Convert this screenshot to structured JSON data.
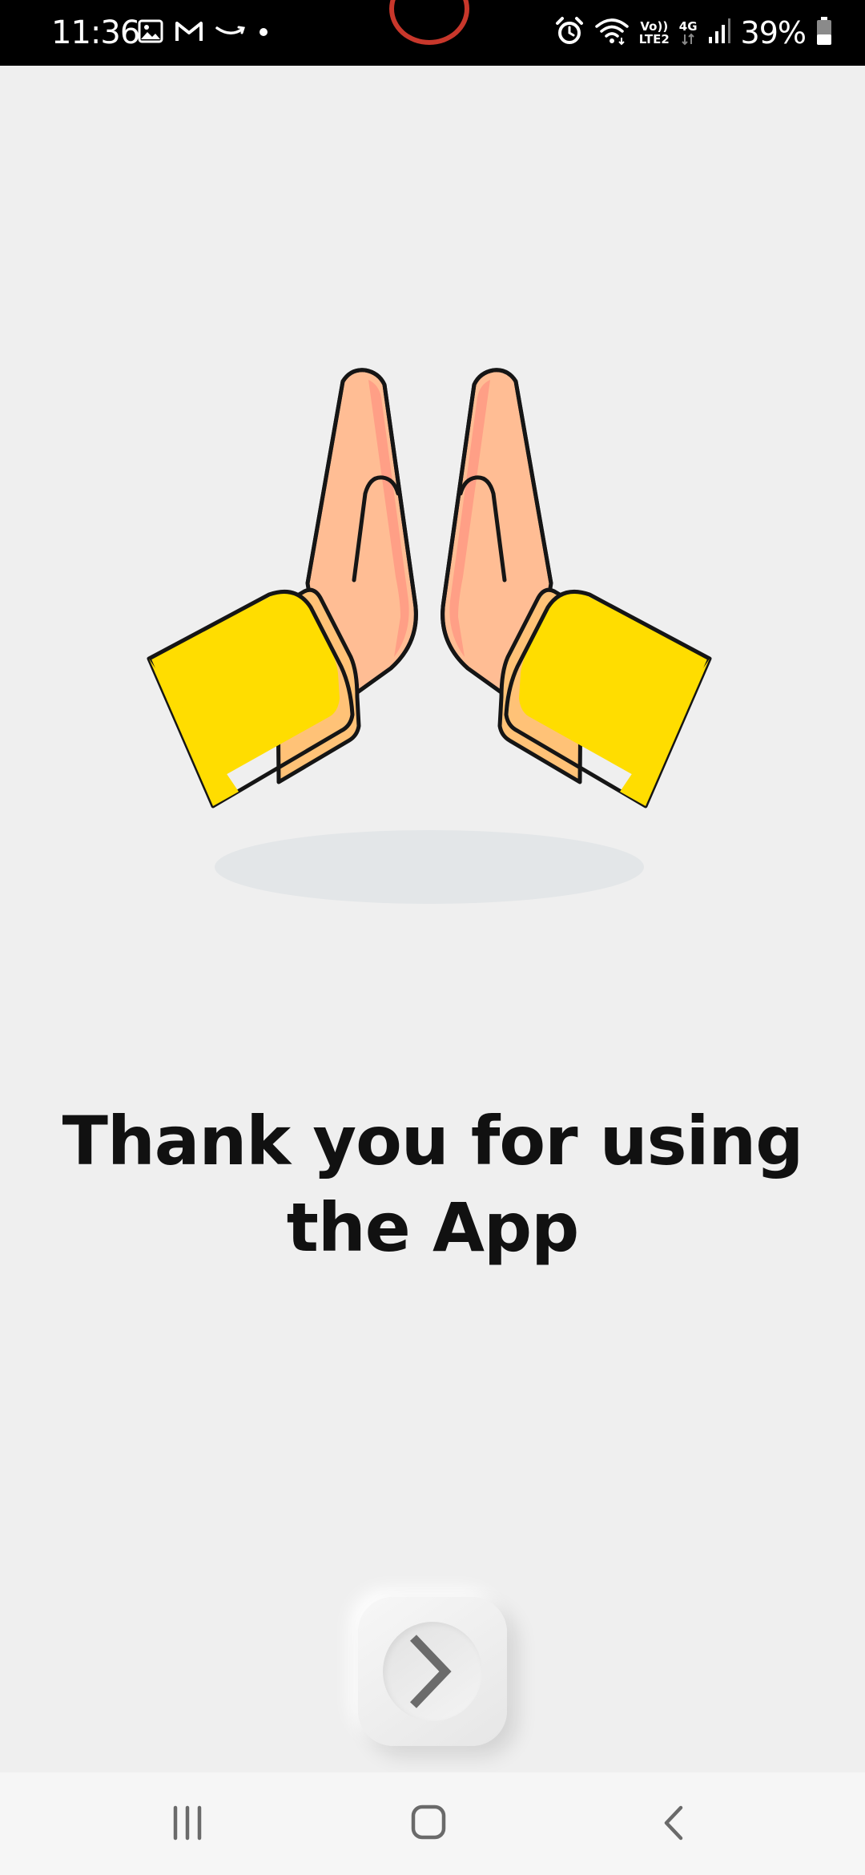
{
  "status_bar": {
    "time": "11:36",
    "battery_percent": "39%",
    "volte_label": "Vo))",
    "lte_label": "LTE2",
    "network_label": "4G",
    "left_icons": [
      "gallery-icon",
      "gmail-icon",
      "amazon-icon",
      "dot-icon"
    ],
    "right_icons": [
      "alarm-icon",
      "wifi-icon",
      "volte-icon",
      "4g-icon",
      "signal-icon",
      "battery-icon"
    ]
  },
  "main": {
    "message": "Thank you for using the App",
    "illustration_icon": "praying-hands-icon",
    "next_button_icon": "chevron-right-icon"
  },
  "nav_bar": {
    "icons": [
      "recent-apps-icon",
      "home-icon",
      "back-icon"
    ]
  },
  "colors": {
    "background": "#efefef",
    "status_bar": "#000000",
    "sleeve": "#ffdd00",
    "skin": "#ffbd94",
    "skin_shade": "#ff9f86",
    "cuff": "#ffc277",
    "shadow": "#e3e6e8",
    "text": "#111111",
    "chevron": "#6b6b6b",
    "camera_ring": "#c8372b"
  }
}
